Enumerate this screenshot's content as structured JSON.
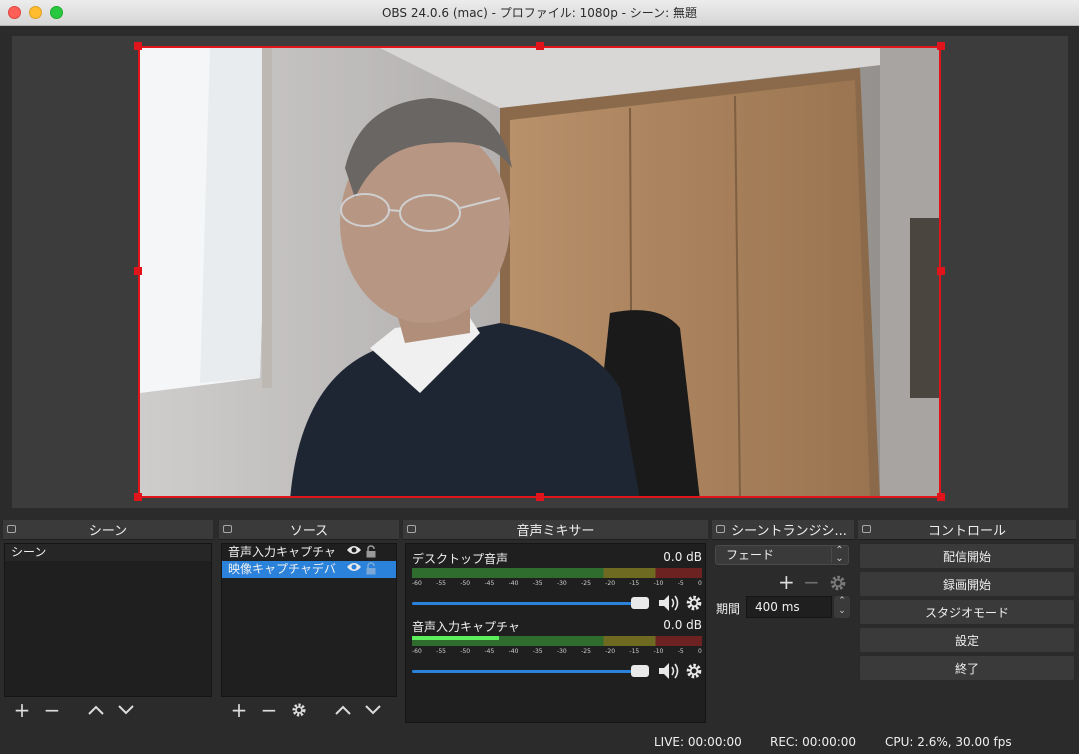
{
  "window": {
    "title": "OBS 24.0.6 (mac) - プロファイル: 1080p - シーン: 無題"
  },
  "docks": {
    "scenes": {
      "title": "シーン",
      "items": [
        "シーン"
      ]
    },
    "sources": {
      "title": "ソース",
      "items": [
        "音声入力キャプチャ",
        "映像キャプチャデバ"
      ]
    },
    "mixer": {
      "title": "音声ミキサー",
      "channels": [
        {
          "name": "デスクトップ音声",
          "db": "0.0 dB",
          "level": 0.0
        },
        {
          "name": "音声入力キャプチャ",
          "db": "0.0 dB",
          "level": 0.3
        }
      ],
      "ticks": [
        "-60",
        "-55",
        "-50",
        "-45",
        "-40",
        "-35",
        "-30",
        "-25",
        "-20",
        "-15",
        "-10",
        "-5",
        "0"
      ]
    },
    "transitions": {
      "title": "シーントランジシ...",
      "selected": "フェード",
      "duration_label": "期間",
      "duration_value": "400 ms"
    },
    "controls": {
      "title": "コントロール",
      "buttons": [
        "配信開始",
        "録画開始",
        "スタジオモード",
        "設定",
        "終了"
      ]
    }
  },
  "status": {
    "live": "LIVE: 00:00:00",
    "rec": "REC: 00:00:00",
    "cpu": "CPU: 2.6%, 30.00 fps"
  },
  "colors": {
    "selection": "#2a82da",
    "source_border": "#e0151b"
  }
}
